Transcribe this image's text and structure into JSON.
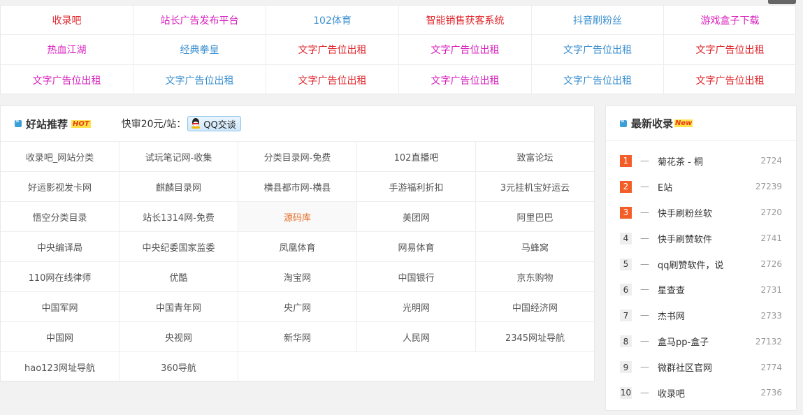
{
  "ads": [
    {
      "label": "收录吧",
      "color": "#e0252b"
    },
    {
      "label": "站长广告发布平台",
      "color": "#d81fbe"
    },
    {
      "label": "102体育",
      "color": "#3a8fd0"
    },
    {
      "label": "智能销售获客系统",
      "color": "#e0252b"
    },
    {
      "label": "抖音刷粉丝",
      "color": "#3a8fd0"
    },
    {
      "label": "游戏盒子下载",
      "color": "#d81fbe"
    },
    {
      "label": "热血江湖",
      "color": "#d81fbe"
    },
    {
      "label": "经典拳皇",
      "color": "#3a8fd0"
    },
    {
      "label": "文字广告位出租",
      "color": "#e0252b"
    },
    {
      "label": "文字广告位出租",
      "color": "#d81fbe"
    },
    {
      "label": "文字广告位出租",
      "color": "#3a8fd0"
    },
    {
      "label": "文字广告位出租",
      "color": "#e0252b"
    },
    {
      "label": "文字广告位出租",
      "color": "#d81fbe"
    },
    {
      "label": "文字广告位出租",
      "color": "#3a8fd0"
    },
    {
      "label": "文字广告位出租",
      "color": "#e0252b"
    },
    {
      "label": "文字广告位出租",
      "color": "#d81fbe"
    },
    {
      "label": "文字广告位出租",
      "color": "#3a8fd0"
    },
    {
      "label": "文字广告位出租",
      "color": "#e0252b"
    }
  ],
  "recommend": {
    "title": "好站推荐",
    "badge": "HOT",
    "review_text": "快审20元/站：",
    "qq_button": "QQ交谈",
    "highlight_color": "#e36f27",
    "sites": [
      {
        "label": "收录吧_网站分类"
      },
      {
        "label": "试玩笔记网-收集"
      },
      {
        "label": "分类目录网-免费"
      },
      {
        "label": "102直播吧"
      },
      {
        "label": "致富论坛"
      },
      {
        "label": "好运影视发卡网"
      },
      {
        "label": "麒麟目录网"
      },
      {
        "label": "横县都市网-横县"
      },
      {
        "label": "手游福利折扣"
      },
      {
        "label": "3元挂机宝好运云"
      },
      {
        "label": "悟空分类目录"
      },
      {
        "label": "站长1314网-免费"
      },
      {
        "label": "源码库",
        "highlight": true
      },
      {
        "label": "美团网"
      },
      {
        "label": "阿里巴巴"
      },
      {
        "label": "中央编译局"
      },
      {
        "label": "中央纪委国家监委"
      },
      {
        "label": "凤凰体育"
      },
      {
        "label": "网易体育"
      },
      {
        "label": "马蜂窝"
      },
      {
        "label": "110网在线律师"
      },
      {
        "label": "优酷"
      },
      {
        "label": "淘宝网"
      },
      {
        "label": "中国银行"
      },
      {
        "label": "京东购物"
      },
      {
        "label": "中国军网"
      },
      {
        "label": "中国青年网"
      },
      {
        "label": "央广网"
      },
      {
        "label": "光明网"
      },
      {
        "label": "中国经济网"
      },
      {
        "label": "中国网"
      },
      {
        "label": "央视网"
      },
      {
        "label": "新华网"
      },
      {
        "label": "人民网"
      },
      {
        "label": "2345网址导航"
      },
      {
        "label": "hao123网址导航"
      },
      {
        "label": "360导航"
      }
    ]
  },
  "latest": {
    "title": "最新收录",
    "badge": "New",
    "top_rank_color": "#f35d27",
    "items": [
      {
        "rank": "1",
        "name": "菊花茶 - 桐",
        "count": "2724"
      },
      {
        "rank": "2",
        "name": "E站",
        "count": "27239"
      },
      {
        "rank": "3",
        "name": "快手刷粉丝软",
        "count": "2720"
      },
      {
        "rank": "4",
        "name": "快手刷赞软件",
        "count": "2741"
      },
      {
        "rank": "5",
        "name": "qq刷赞软件，说",
        "count": "2726"
      },
      {
        "rank": "6",
        "name": "星查查",
        "count": "2731"
      },
      {
        "rank": "7",
        "name": "杰书网",
        "count": "2733"
      },
      {
        "rank": "8",
        "name": "盒马pp-盒子",
        "count": "27132"
      },
      {
        "rank": "9",
        "name": "微群社区官网",
        "count": "2774"
      },
      {
        "rank": "10",
        "name": "收录吧",
        "count": "2736"
      }
    ]
  }
}
